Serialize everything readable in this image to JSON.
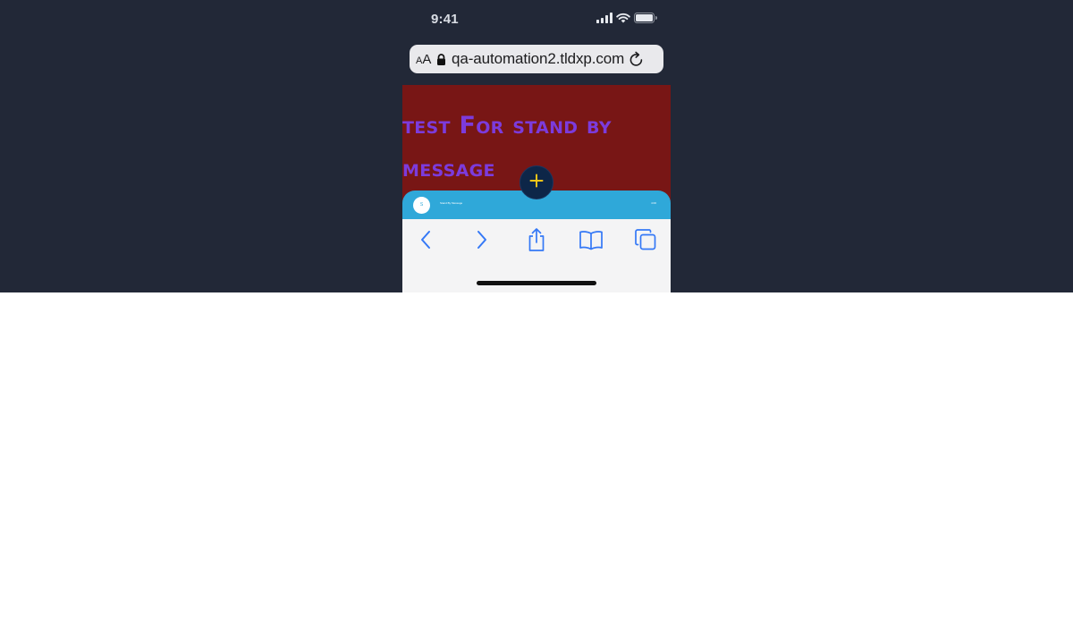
{
  "status_bar": {
    "time": "9:41"
  },
  "browser": {
    "aa_small": "A",
    "aa_large": "A",
    "url": "qa-automation2.tldxp.com"
  },
  "page": {
    "heading_line1": "test For stand by",
    "heading_line2": "message"
  },
  "fab": {
    "icon": "plus-icon",
    "label": "+"
  },
  "chat_bar": {
    "avatar_text": "S",
    "name": "Stand By Message",
    "time": "4:00"
  },
  "toolbar": {
    "icons": [
      "back-icon",
      "forward-icon",
      "share-icon",
      "bookmarks-icon",
      "tabs-icon"
    ]
  },
  "colors": {
    "backdrop": "#222837",
    "page_background": "#781615",
    "heading": "#7c3bdc",
    "fab_background": "#0d2648",
    "fab_plus": "#f5c518",
    "chat_bar": "#2fa8d9",
    "toolbar_icons": "#3478f6"
  }
}
